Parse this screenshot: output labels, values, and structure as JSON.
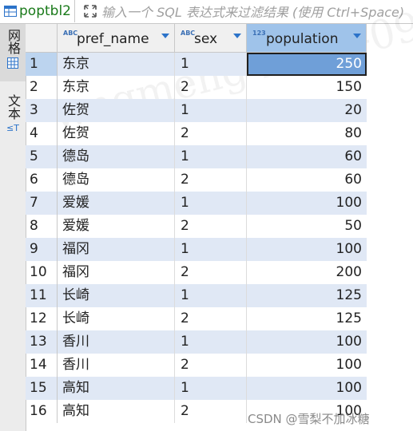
{
  "tab": {
    "label": "poptbl2",
    "icon": "table-icon"
  },
  "filter": {
    "placeholder": "输入一个 SQL 表达式来过滤结果 (使用 Ctrl+Space)",
    "icon": "filter-expand-icon"
  },
  "sidebar": {
    "grid_label": "网格",
    "text_label": "文本"
  },
  "columns": [
    {
      "type": "ABC",
      "name": "pref_name"
    },
    {
      "type": "ABC",
      "name": "sex"
    },
    {
      "type": "123",
      "name": "population"
    }
  ],
  "rows": [
    {
      "num": "1",
      "pref_name": "东京",
      "sex": "1",
      "population": "250"
    },
    {
      "num": "2",
      "pref_name": "东京",
      "sex": "2",
      "population": "150"
    },
    {
      "num": "3",
      "pref_name": "佐贺",
      "sex": "1",
      "population": "20"
    },
    {
      "num": "4",
      "pref_name": "佐贺",
      "sex": "2",
      "population": "80"
    },
    {
      "num": "5",
      "pref_name": "德岛",
      "sex": "1",
      "population": "60"
    },
    {
      "num": "6",
      "pref_name": "德岛",
      "sex": "2",
      "population": "60"
    },
    {
      "num": "7",
      "pref_name": "爱媛",
      "sex": "1",
      "population": "100"
    },
    {
      "num": "8",
      "pref_name": "爱媛",
      "sex": "2",
      "population": "50"
    },
    {
      "num": "9",
      "pref_name": "福冈",
      "sex": "1",
      "population": "100"
    },
    {
      "num": "10",
      "pref_name": "福冈",
      "sex": "2",
      "population": "200"
    },
    {
      "num": "11",
      "pref_name": "长崎",
      "sex": "1",
      "population": "125"
    },
    {
      "num": "12",
      "pref_name": "长崎",
      "sex": "2",
      "population": "125"
    },
    {
      "num": "13",
      "pref_name": "香川",
      "sex": "1",
      "population": "100"
    },
    {
      "num": "14",
      "pref_name": "香川",
      "sex": "2",
      "population": "100"
    },
    {
      "num": "15",
      "pref_name": "高知",
      "sex": "1",
      "population": "100"
    },
    {
      "num": "16",
      "pref_name": "高知",
      "sex": "2",
      "population": "100"
    }
  ],
  "watermark": "CSDN @雪梨不加冰糖",
  "colors": {
    "tab_text": "#1a7a1a",
    "row_alt": "#e0e8f5",
    "selected_cell": "#6f9fd8",
    "header_selected": "#9fc3ea"
  }
}
